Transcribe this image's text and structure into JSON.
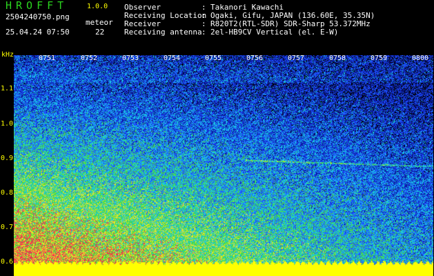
{
  "app": {
    "title": "HROFFT",
    "version": "1.0.0",
    "file_name": "2504240750.png",
    "timestamp": "25.04.24 07:50",
    "meteor_label": "meteor",
    "meteor_count": "22"
  },
  "info": [
    {
      "label": "Observer",
      "value": "Takanori Kawachi"
    },
    {
      "label": "Receiving Location",
      "value": "Ogaki, Gifu, JAPAN (136.60E, 35.35N)"
    },
    {
      "label": "Receiver",
      "value": "R820T2(RTL-SDR) SDR-Sharp 53.372MHz"
    },
    {
      "label": "Receiving antenna",
      "value": "2el-HB9CV Vertical (el. E-W)"
    }
  ],
  "axis": {
    "unit": "kHz",
    "y_ticks": [
      "1.1",
      "1.0",
      "0.9",
      "0.8",
      "0.7",
      "0.6"
    ],
    "x_ticks": [
      "0751",
      "0752",
      "0753",
      "0754",
      "0755",
      "0756",
      "0757",
      "0758",
      "0759",
      "0800"
    ]
  },
  "colors": {
    "background": "#000000",
    "label_yellow": "#ffff00",
    "title_green": "#2bd41f",
    "noise_dark_blue": "#0a1aa0",
    "noise_blue": "#1e50ff",
    "noise_cyan": "#19c8e6",
    "noise_green": "#46dc46",
    "noise_yellow": "#e6e628",
    "noise_red": "#ff2850",
    "floor_yellow": "#ffff00"
  }
}
